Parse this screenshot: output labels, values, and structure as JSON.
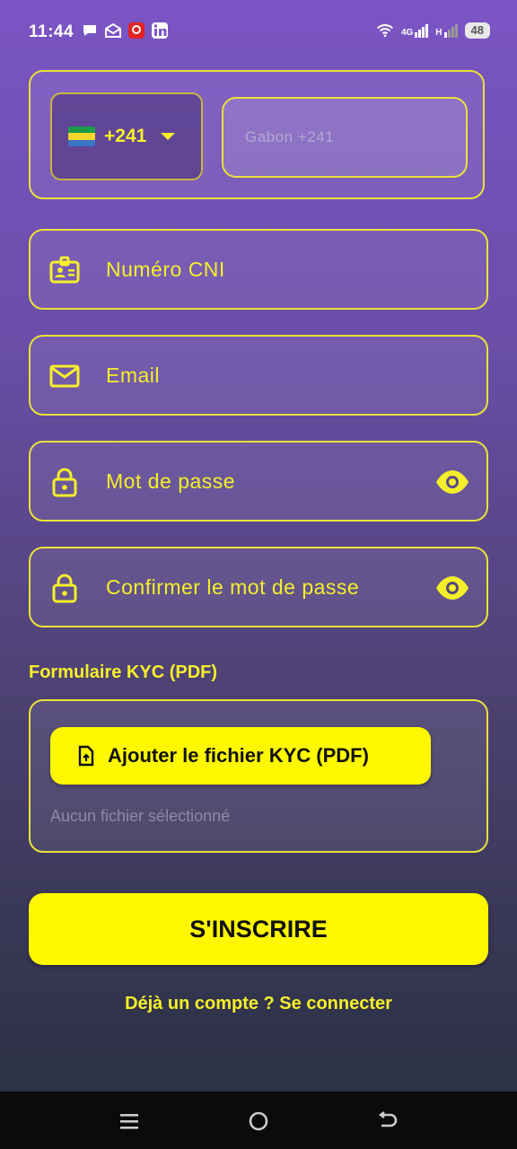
{
  "status_bar": {
    "time": "11:44",
    "battery": "48",
    "network_4g": "4G",
    "network_h": "H"
  },
  "phone": {
    "country_code": "+241",
    "placeholder": "Gabon +241",
    "flag_colors": [
      "#1a9c4a",
      "#f3d52b",
      "#3a75c4"
    ]
  },
  "fields": {
    "cni_label": "Numéro CNI",
    "email_label": "Email",
    "password_label": "Mot de passe",
    "confirm_password_label": "Confirmer le mot de passe"
  },
  "kyc": {
    "title": "Formulaire KYC (PDF)",
    "button_label": "Ajouter le fichier KYC (PDF)",
    "status": "Aucun fichier sélectionné"
  },
  "actions": {
    "submit_label": "S'INSCRIRE",
    "login_link": "Déjà un compte ? Se connecter"
  },
  "colors": {
    "accent": "#fff800",
    "text_accent": "#f5ef2a"
  }
}
